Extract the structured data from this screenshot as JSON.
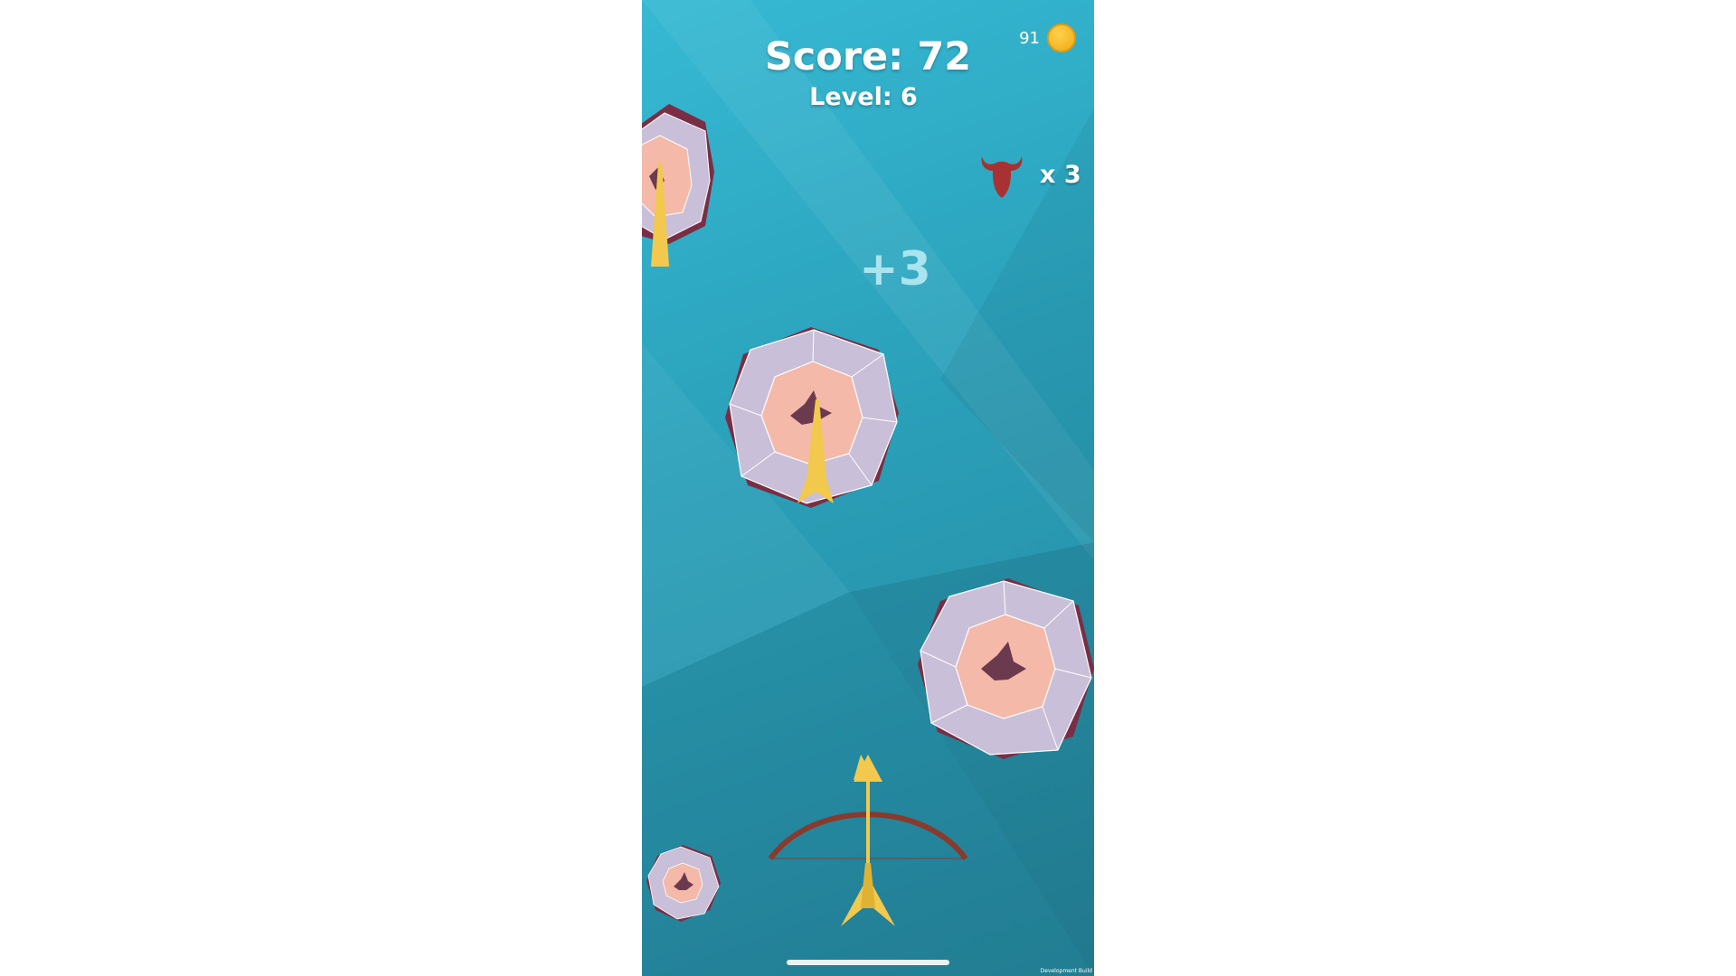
{
  "hud": {
    "score_label": "Score: 72",
    "level_label": "Level: 6",
    "coin_count": "91",
    "lives_count": "x 3",
    "bonus_popup": "+3",
    "dev_build_label": "Development Build"
  },
  "icons": {
    "coin": "coin-icon",
    "lives": "bull-head-icon",
    "weapon": "bow-icon",
    "target": "origami-crane-target-icon"
  },
  "colors": {
    "background_top": "#36b9d4",
    "background_bottom": "#25859c",
    "target_outer": "#c9bfd8",
    "target_inner": "#f4b9a9",
    "target_rim": "#7a2e45",
    "arrow": "#f2c94c",
    "bow": "#8a3a2c",
    "bull": "#a83232",
    "coin": "#f5b823"
  }
}
